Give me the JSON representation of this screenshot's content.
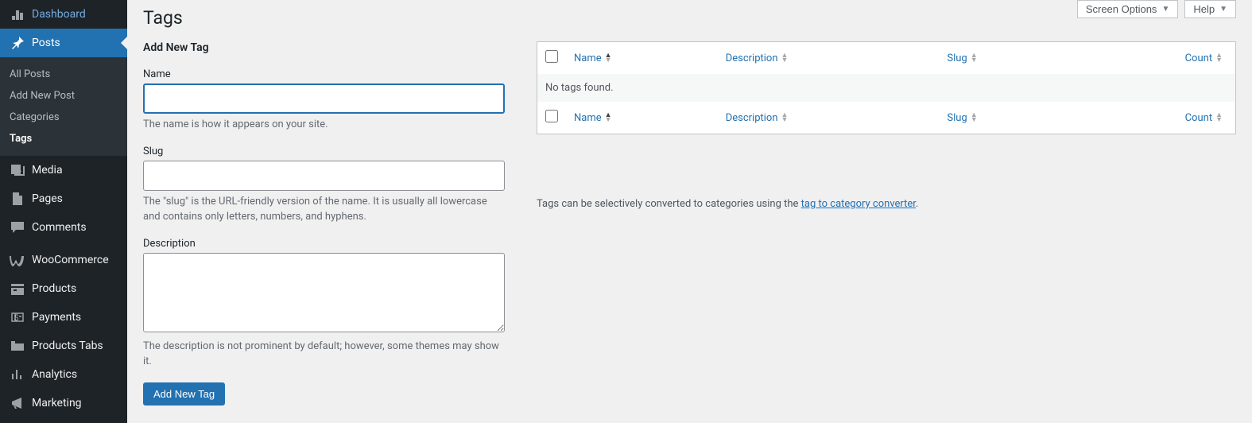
{
  "topButtons": {
    "screenOptions": "Screen Options",
    "help": "Help"
  },
  "sidebar": {
    "dashboard": "Dashboard",
    "posts": "Posts",
    "submenu": {
      "allPosts": "All Posts",
      "addNew": "Add New Post",
      "categories": "Categories",
      "tags": "Tags"
    },
    "media": "Media",
    "pages": "Pages",
    "comments": "Comments",
    "woocommerce": "WooCommerce",
    "products": "Products",
    "payments": "Payments",
    "productsTabs": "Products Tabs",
    "analytics": "Analytics",
    "marketing": "Marketing"
  },
  "page": {
    "title": "Tags",
    "sectionTitle": "Add New Tag"
  },
  "form": {
    "name": {
      "label": "Name",
      "value": "",
      "help": "The name is how it appears on your site."
    },
    "slug": {
      "label": "Slug",
      "value": "",
      "help": "The \"slug\" is the URL-friendly version of the name. It is usually all lowercase and contains only letters, numbers, and hyphens."
    },
    "description": {
      "label": "Description",
      "value": "",
      "help": "The description is not prominent by default; however, some themes may show it."
    },
    "submit": "Add New Tag"
  },
  "table": {
    "headers": {
      "name": "Name",
      "description": "Description",
      "slug": "Slug",
      "count": "Count"
    },
    "empty": "No tags found."
  },
  "note": {
    "text": "Tags can be selectively converted to categories using the ",
    "link": "tag to category converter",
    "suffix": "."
  }
}
